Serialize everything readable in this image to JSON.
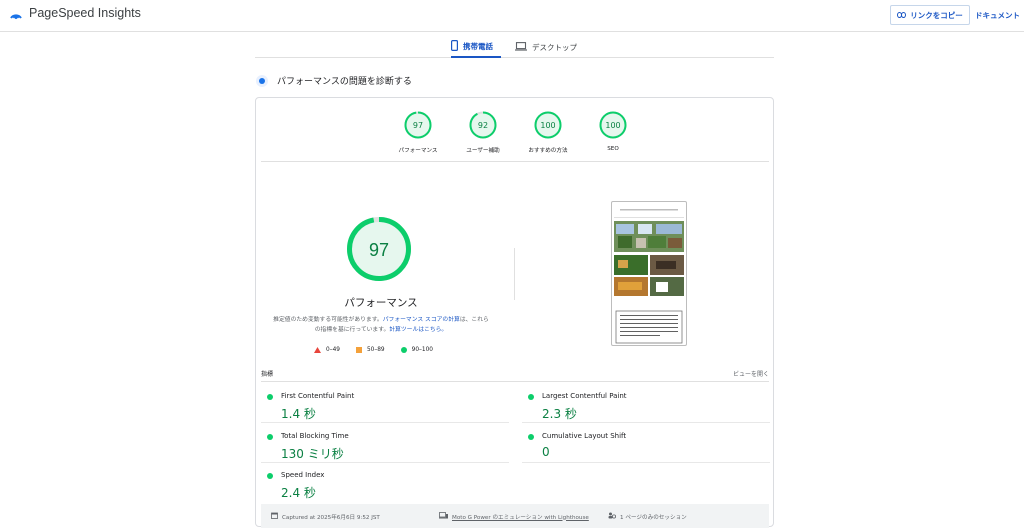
{
  "header": {
    "app_title": "PageSpeed Insights",
    "copy_link_label": "リンクをコピー",
    "docs_label": "ドキュメント"
  },
  "tabs": [
    {
      "label": "携帯電話",
      "active": true,
      "icon": "phone-icon"
    },
    {
      "label": "デスクトップ",
      "active": false,
      "icon": "laptop-icon"
    }
  ],
  "diagnose": {
    "title": "パフォーマンスの問題を診断する"
  },
  "categories": [
    {
      "score": "97",
      "label": "パフォーマンス",
      "fraction": 0.97
    },
    {
      "score": "92",
      "label": "ユーザー補助",
      "fraction": 0.92
    },
    {
      "score": "100",
      "label": "おすすめの方法",
      "fraction": 1.0
    },
    {
      "score": "100",
      "label": "SEO",
      "fraction": 1.0
    }
  ],
  "performance": {
    "score": "97",
    "fraction": 0.97,
    "label": "パフォーマンス",
    "desc_1": "推定値のため変動する可能性があります。",
    "desc_link_1": "パフォーマンス スコアの計算",
    "desc_2": "は、これらの指標を基に行っています。",
    "desc_link_2": "計算ツールはこちら。"
  },
  "legend": [
    {
      "range": "0–49",
      "shape": "triangle",
      "color": "#e8453c"
    },
    {
      "range": "50–89",
      "shape": "square",
      "color": "#f4a13b"
    },
    {
      "range": "90–100",
      "shape": "circle",
      "color": "#0cce6b"
    }
  ],
  "metrics_section": {
    "title": "指標",
    "expand_label": "ビューを開く"
  },
  "metrics": [
    {
      "name": "First Contentful Paint",
      "value": "1.4 秒"
    },
    {
      "name": "Largest Contentful Paint",
      "value": "2.3 秒"
    },
    {
      "name": "Total Blocking Time",
      "value": "130 ミリ秒"
    },
    {
      "name": "Cumulative Layout Shift",
      "value": "0"
    },
    {
      "name": "Speed Index",
      "value": "2.4 秒"
    }
  ],
  "footer": {
    "captured": "Captured at 2025年6月6日 9:52 JST",
    "device": "Moto G Power のエミュレーション with Lighthouse",
    "session": "1 ページのみのセッション"
  },
  "colors": {
    "pass": "#0cce6b",
    "pass_text": "#0b8043",
    "link": "#1a56c4"
  }
}
